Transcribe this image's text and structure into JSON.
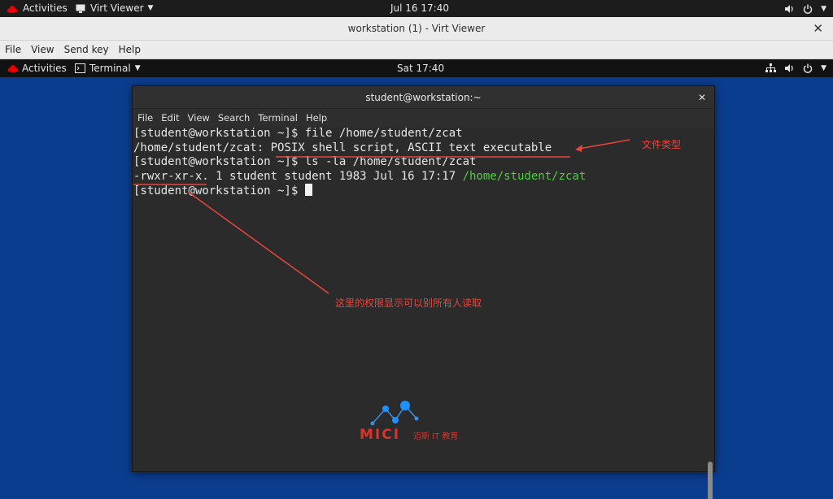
{
  "host_bar": {
    "activities": "Activities",
    "app_name": "Virt Viewer",
    "clock": "Jul 16  17:40"
  },
  "virt_viewer": {
    "title": "workstation (1) - Virt Viewer",
    "menu": [
      "File",
      "View",
      "Send key",
      "Help"
    ]
  },
  "guest_bar": {
    "activities": "Activities",
    "app_name": "Terminal",
    "clock": "Sat 17:40"
  },
  "terminal": {
    "title": "student@workstation:~",
    "menu": [
      "File",
      "Edit",
      "View",
      "Search",
      "Terminal",
      "Help"
    ],
    "lines": [
      "[student@workstation ~]$ file /home/student/zcat",
      "/home/student/zcat: POSIX shell script, ASCII text executable",
      "[student@workstation ~]$ ls -la /home/student/zcat"
    ],
    "ls_output_prefix": "-rwxr-xr-x. 1 student student 1983 Jul 16 17:17 ",
    "ls_output_path": "/home/student/zcat",
    "prompt": "[student@workstation ~]$ "
  },
  "annotations": {
    "file_type": "文件类型",
    "permissions": "这里的权限显示可以别所有人读取"
  },
  "watermark": {
    "logo": "MICI",
    "sub": "迈斯 IT 教育"
  },
  "colors": {
    "desktop_bg": "#0b3d8f",
    "annotation": "#e8453c",
    "terminal_green": "#4fcf3f"
  }
}
